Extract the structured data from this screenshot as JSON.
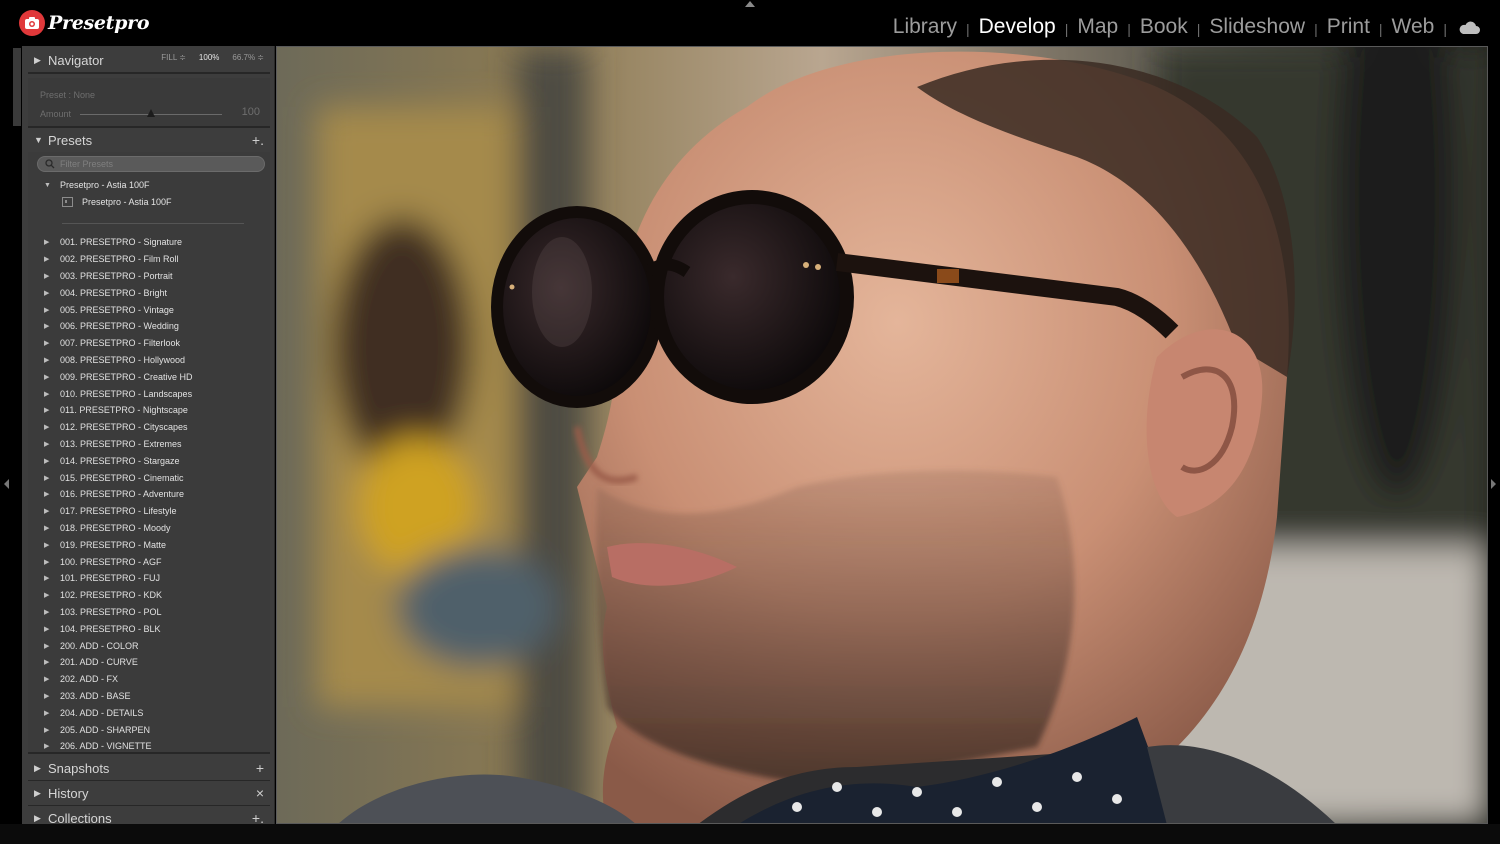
{
  "brand": {
    "name": "Presetpro",
    "logo_icon": "camera-icon",
    "accent": "#e0383a"
  },
  "modules": [
    "Library",
    "Develop",
    "Map",
    "Book",
    "Slideshow",
    "Print",
    "Web"
  ],
  "active_module": "Develop",
  "cloud_icon": "cloud-icon",
  "navigator": {
    "title": "Navigator",
    "fill": "FILL ≑",
    "zoom_100": "100%",
    "zoom_other": "66.7% ≑"
  },
  "amount": {
    "preset": "Preset : None",
    "label": "Amount",
    "value": "100",
    "level": 0.5
  },
  "presets": {
    "title": "Presets",
    "add": "+.",
    "filter_placeholder": "Filter Presets",
    "open_group": "Presetpro - Astia 100F",
    "open_item": "Presetpro - Astia 100F",
    "groups": [
      "001. PRESETPRO - Signature",
      "002. PRESETPRO - Film Roll",
      "003. PRESETPRO - Portrait",
      "004. PRESETPRO - Bright",
      "005. PRESETPRO - Vintage",
      "006. PRESETPRO - Wedding",
      "007. PRESETPRO - Filterlook",
      "008. PRESETPRO - Hollywood",
      "009. PRESETPRO - Creative HD",
      "010. PRESETPRO - Landscapes",
      "011. PRESETPRO - Nightscape",
      "012. PRESETPRO - Cityscapes",
      "013. PRESETPRO - Extremes",
      "014. PRESETPRO - Stargaze",
      "015. PRESETPRO - Cinematic",
      "016. PRESETPRO - Adventure",
      "017. PRESETPRO - Lifestyle",
      "018. PRESETPRO - Moody",
      "019. PRESETPRO - Matte",
      "100. PRESETPRO - AGF",
      "101. PRESETPRO - FUJ",
      "102. PRESETPRO - KDK",
      "103. PRESETPRO - POL",
      "104. PRESETPRO - BLK",
      "200. ADD - COLOR",
      "201. ADD - CURVE",
      "202. ADD - FX",
      "203. ADD - BASE",
      "204. ADD - DETAILS",
      "205. ADD - SHARPEN",
      "206. ADD - VIGNETTE"
    ]
  },
  "snapshots": {
    "title": "Snapshots",
    "action": "+"
  },
  "history": {
    "title": "History",
    "action": "×"
  },
  "collections": {
    "title": "Collections",
    "action": "+."
  },
  "tri_closed": "▶",
  "tri_open": "▼",
  "photo": {
    "subject": "portrait-photo"
  }
}
